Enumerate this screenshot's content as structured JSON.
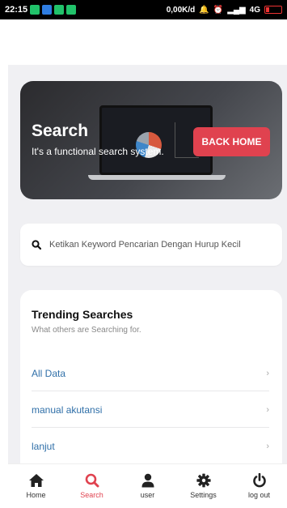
{
  "status_bar": {
    "time": "22:15",
    "network_speed": "0,00K/d",
    "signal": "4G"
  },
  "banner": {
    "title": "Search",
    "subtitle": "It's a functional search system.",
    "back_button_label": "BACK HOME"
  },
  "search": {
    "placeholder": "Ketikan Keyword Pencarian Dengan Hurup Kecil",
    "value": ""
  },
  "trending": {
    "title": "Trending Searches",
    "subtitle": "What others are Searching for.",
    "items": [
      {
        "label": "All Data"
      },
      {
        "label": "manual akutansi"
      },
      {
        "label": "lanjut"
      }
    ]
  },
  "bottom_nav": {
    "items": [
      {
        "label": "Home",
        "icon": "home-icon"
      },
      {
        "label": "Search",
        "icon": "search-icon",
        "active": true
      },
      {
        "label": "user",
        "icon": "user-icon"
      },
      {
        "label": "Settings",
        "icon": "gear-icon"
      },
      {
        "label": "log out",
        "icon": "power-icon"
      }
    ]
  },
  "colors": {
    "accent": "#e0424f",
    "link": "#2f6fa8",
    "background": "#f0f0f3"
  }
}
